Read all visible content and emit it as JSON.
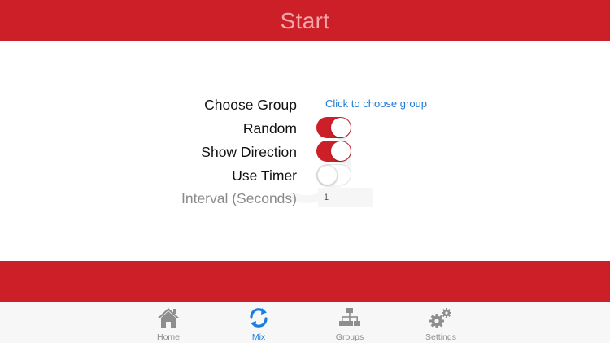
{
  "header": {
    "title": "Start"
  },
  "form": {
    "choose_group": {
      "label": "Choose Group",
      "link": "Click to choose group"
    },
    "random": {
      "label": "Random",
      "on": true
    },
    "show_direction": {
      "label": "Show Direction",
      "on": true
    },
    "use_timer": {
      "label": "Use Timer",
      "on": false
    },
    "interval": {
      "label": "Interval (Seconds)",
      "value": "1"
    }
  },
  "tabbar": {
    "tabs": [
      {
        "label": "Home",
        "icon": "home-icon",
        "active": false
      },
      {
        "label": "Mix",
        "icon": "refresh-icon",
        "active": true
      },
      {
        "label": "Groups",
        "icon": "hierarchy-icon",
        "active": false
      },
      {
        "label": "Settings",
        "icon": "gears-icon",
        "active": false
      }
    ]
  },
  "colors": {
    "accent": "#cc1f28",
    "active_tab": "#1a7de0",
    "inactive_tab": "#8e8e8e"
  }
}
